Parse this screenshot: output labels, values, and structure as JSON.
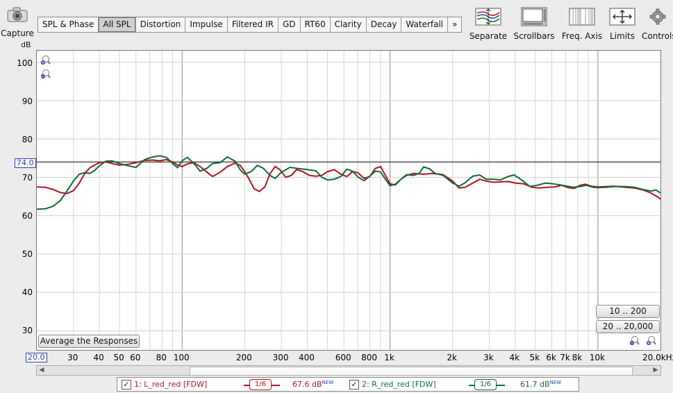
{
  "toolbar": {
    "capture_label": "Capture",
    "tabs": [
      "SPL & Phase",
      "All SPL",
      "Distortion",
      "Impulse",
      "Filtered IR",
      "GD",
      "RT60",
      "Clarity",
      "Decay",
      "Waterfall",
      "»"
    ],
    "active_tab": "All SPL",
    "tools": [
      "Separate",
      "Scrollbars",
      "Freq. Axis",
      "Limits",
      "Controls"
    ]
  },
  "graph": {
    "y_unit": "dB",
    "y_ticks": [
      "100",
      "90",
      "80",
      "70",
      "60",
      "50",
      "40",
      "30"
    ],
    "x_ticks": [
      "30",
      "40",
      "50",
      "60",
      "80",
      "100",
      "200",
      "300",
      "400",
      "600",
      "800",
      "1k",
      "2k",
      "3k",
      "4k",
      "5k",
      "6k",
      "7k",
      "8k",
      "10k",
      "20.0kHz"
    ],
    "cursor_value": "74.0",
    "x_start_value": "20.0",
    "average_button": "Average the Responses",
    "range_buttons": [
      "10 .. 200",
      "20 .. 20,000"
    ]
  },
  "legend": [
    {
      "checked": "✓",
      "label": "1: L_red_red [FDW]",
      "smoothing": "1/6",
      "value": "67.6 dB",
      "badge": "NEW",
      "color": "#b3121b"
    },
    {
      "checked": "✓",
      "label": "2: R_red_red [FDW]",
      "smoothing": "1/6",
      "value": "61.7 dB",
      "badge": "NEW",
      "color": "#0e6b3b"
    }
  ],
  "chart_data": {
    "type": "line",
    "x_scale": "log",
    "xlim": [
      20,
      20000
    ],
    "ylim": [
      25,
      103
    ],
    "ylabel": "dB",
    "grid": true,
    "reference_line": 74.0,
    "series": [
      {
        "name": "1: L_red_red [FDW]",
        "color": "#b3121b",
        "points": [
          [
            20,
            67.5
          ],
          [
            22,
            67.4
          ],
          [
            24,
            66.8
          ],
          [
            26,
            66
          ],
          [
            28,
            65.8
          ],
          [
            30,
            66.5
          ],
          [
            32,
            68.5
          ],
          [
            34,
            71
          ],
          [
            36,
            72.5
          ],
          [
            38,
            73.2
          ],
          [
            40,
            73.8
          ],
          [
            43,
            74
          ],
          [
            46,
            73.6
          ],
          [
            50,
            73.2
          ],
          [
            55,
            73.4
          ],
          [
            60,
            73.8
          ],
          [
            66,
            74.4
          ],
          [
            72,
            74.5
          ],
          [
            78,
            74.3
          ],
          [
            84,
            74.6
          ],
          [
            90,
            74
          ],
          [
            95,
            73.2
          ],
          [
            100,
            72.8
          ],
          [
            106,
            73.5
          ],
          [
            114,
            73.8
          ],
          [
            122,
            72.8
          ],
          [
            132,
            71.3
          ],
          [
            140,
            70.2
          ],
          [
            152,
            71.3
          ],
          [
            165,
            72.8
          ],
          [
            180,
            73.7
          ],
          [
            190,
            73.1
          ],
          [
            200,
            71.5
          ],
          [
            210,
            69.5
          ],
          [
            222,
            67
          ],
          [
            235,
            66.3
          ],
          [
            250,
            67.5
          ],
          [
            265,
            71
          ],
          [
            280,
            72.8
          ],
          [
            295,
            72
          ],
          [
            315,
            70
          ],
          [
            335,
            70.5
          ],
          [
            355,
            72
          ],
          [
            380,
            71.5
          ],
          [
            410,
            70.5
          ],
          [
            440,
            70.3
          ],
          [
            470,
            70.5
          ],
          [
            500,
            71.5
          ],
          [
            540,
            72
          ],
          [
            580,
            70.8
          ],
          [
            620,
            70.2
          ],
          [
            660,
            71.5
          ],
          [
            700,
            71.2
          ],
          [
            750,
            69.7
          ],
          [
            800,
            70.2
          ],
          [
            850,
            72.3
          ],
          [
            900,
            72.8
          ],
          [
            950,
            70.5
          ],
          [
            1000,
            68.3
          ],
          [
            1060,
            68
          ],
          [
            1130,
            69.5
          ],
          [
            1200,
            70.5
          ],
          [
            1300,
            71
          ],
          [
            1450,
            70.8
          ],
          [
            1600,
            71
          ],
          [
            1800,
            70.7
          ],
          [
            2000,
            69
          ],
          [
            2150,
            67.2
          ],
          [
            2300,
            67.4
          ],
          [
            2500,
            68.5
          ],
          [
            2700,
            69.5
          ],
          [
            2900,
            69
          ],
          [
            3150,
            68.7
          ],
          [
            3400,
            68.8
          ],
          [
            3700,
            68.9
          ],
          [
            4000,
            68.5
          ],
          [
            4400,
            68.3
          ],
          [
            4800,
            67.4
          ],
          [
            5200,
            67.2
          ],
          [
            5700,
            67.4
          ],
          [
            6200,
            67.5
          ],
          [
            6700,
            67.9
          ],
          [
            7200,
            67.3
          ],
          [
            7700,
            67.1
          ],
          [
            8200,
            67.9
          ],
          [
            8700,
            68.2
          ],
          [
            9300,
            67.7
          ],
          [
            10000,
            67.5
          ],
          [
            11000,
            67.6
          ],
          [
            12000,
            67.7
          ],
          [
            13500,
            67.4
          ],
          [
            15000,
            67.2
          ],
          [
            16500,
            66.7
          ],
          [
            18000,
            65.9
          ],
          [
            19500,
            64.8
          ],
          [
            20000,
            64.3
          ]
        ]
      },
      {
        "name": "2: R_red_red [FDW]",
        "color": "#0e6b3b",
        "points": [
          [
            20,
            61.7
          ],
          [
            22,
            61.8
          ],
          [
            24,
            62.5
          ],
          [
            26,
            64
          ],
          [
            28,
            66.5
          ],
          [
            30,
            69
          ],
          [
            32,
            70.8
          ],
          [
            34,
            71.2
          ],
          [
            36,
            71
          ],
          [
            38,
            71.8
          ],
          [
            40,
            73
          ],
          [
            43,
            74.2
          ],
          [
            46,
            74.3
          ],
          [
            50,
            73.6
          ],
          [
            55,
            73
          ],
          [
            60,
            72.6
          ],
          [
            66,
            74.6
          ],
          [
            72,
            75.3
          ],
          [
            78,
            75.6
          ],
          [
            84,
            75.2
          ],
          [
            90,
            73.6
          ],
          [
            95,
            72.5
          ],
          [
            100,
            74.3
          ],
          [
            106,
            75.2
          ],
          [
            114,
            73.6
          ],
          [
            122,
            71.6
          ],
          [
            132,
            72.4
          ],
          [
            140,
            73.6
          ],
          [
            152,
            73.8
          ],
          [
            165,
            75.3
          ],
          [
            180,
            74.2
          ],
          [
            190,
            72
          ],
          [
            200,
            70.8
          ],
          [
            215,
            71.5
          ],
          [
            230,
            73.1
          ],
          [
            245,
            72.4
          ],
          [
            265,
            70.5
          ],
          [
            280,
            69.7
          ],
          [
            300,
            71.3
          ],
          [
            330,
            72.6
          ],
          [
            360,
            72.3
          ],
          [
            400,
            72
          ],
          [
            440,
            71.7
          ],
          [
            470,
            70
          ],
          [
            500,
            69.3
          ],
          [
            540,
            69.5
          ],
          [
            580,
            70.2
          ],
          [
            620,
            72.1
          ],
          [
            660,
            71.6
          ],
          [
            700,
            70.1
          ],
          [
            750,
            69.1
          ],
          [
            800,
            70.3
          ],
          [
            850,
            71.6
          ],
          [
            900,
            71.4
          ],
          [
            950,
            69.5
          ],
          [
            1000,
            67.8
          ],
          [
            1060,
            68.2
          ],
          [
            1130,
            69.5
          ],
          [
            1200,
            70.7
          ],
          [
            1300,
            70.5
          ],
          [
            1380,
            71
          ],
          [
            1450,
            72.7
          ],
          [
            1550,
            72.2
          ],
          [
            1650,
            71
          ],
          [
            1800,
            70.5
          ],
          [
            2000,
            68.5
          ],
          [
            2150,
            67.7
          ],
          [
            2300,
            68.6
          ],
          [
            2500,
            70.3
          ],
          [
            2700,
            70.6
          ],
          [
            2900,
            69.5
          ],
          [
            3150,
            69.5
          ],
          [
            3400,
            69.3
          ],
          [
            3700,
            70.2
          ],
          [
            3950,
            70.6
          ],
          [
            4300,
            69.3
          ],
          [
            4700,
            67.6
          ],
          [
            5100,
            67.9
          ],
          [
            5600,
            68.5
          ],
          [
            6100,
            68.3
          ],
          [
            6600,
            68
          ],
          [
            7100,
            67.7
          ],
          [
            7600,
            67.4
          ],
          [
            8200,
            67.6
          ],
          [
            8800,
            67.9
          ],
          [
            9500,
            67.4
          ],
          [
            10000,
            67.3
          ],
          [
            11000,
            67.4
          ],
          [
            12000,
            67.6
          ],
          [
            13500,
            67.6
          ],
          [
            15000,
            67.4
          ],
          [
            16500,
            66.8
          ],
          [
            18000,
            66.4
          ],
          [
            19000,
            66.7
          ],
          [
            20000,
            65.9
          ]
        ]
      }
    ]
  }
}
